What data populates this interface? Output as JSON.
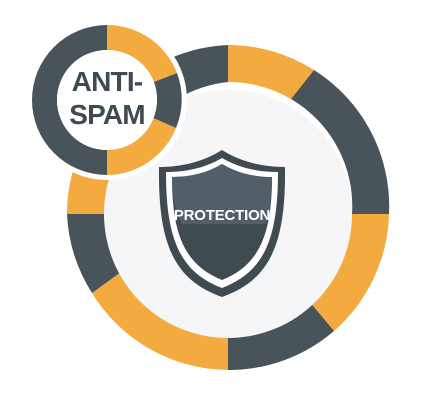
{
  "graphic": {
    "shield_label": "PROTECTION",
    "badge_line_1": "ANTI-",
    "badge_line_2": "SPAM"
  },
  "colors": {
    "orange": "#f3aa3f",
    "slate": "#49535a",
    "inner_light": "#f5f6f7",
    "white": "#ffffff",
    "shield_dark": "#3f4a51",
    "shield_highlight": "#55626a"
  },
  "icons": {
    "main": "shield-icon"
  }
}
